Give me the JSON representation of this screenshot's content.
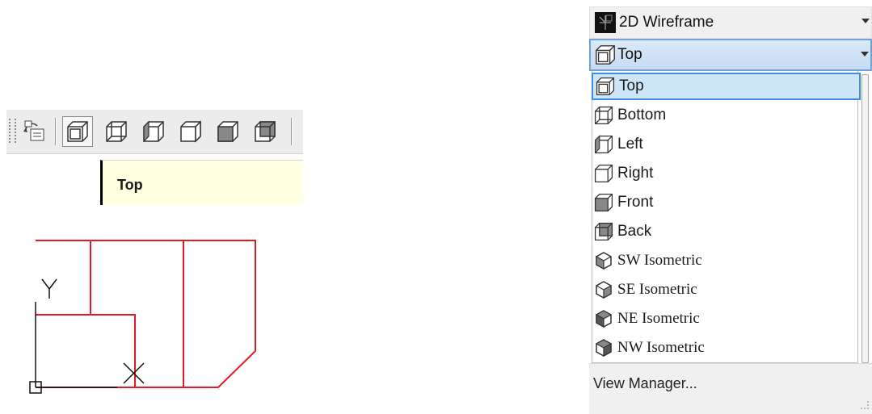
{
  "toolbar": {
    "buttons": [
      {
        "name": "named-views",
        "icon": "named-views-icon"
      },
      {
        "name": "top",
        "icon": "view-top-icon"
      },
      {
        "name": "bottom",
        "icon": "view-bottom-icon"
      },
      {
        "name": "left",
        "icon": "view-left-icon"
      },
      {
        "name": "right",
        "icon": "view-right-icon"
      },
      {
        "name": "front",
        "icon": "view-front-icon"
      },
      {
        "name": "back",
        "icon": "view-back-icon"
      }
    ],
    "tooltip": "Top"
  },
  "drawing": {
    "line_color": "#e01b24",
    "ucs_color": "#000000",
    "y_label": "Y",
    "x_label": "X"
  },
  "dropdown": {
    "visual_style": "2D Wireframe",
    "current_view": "Top",
    "items": [
      {
        "label": "Top",
        "icon": "view-top-icon",
        "selected": true
      },
      {
        "label": "Bottom",
        "icon": "view-bottom-icon",
        "selected": false
      },
      {
        "label": "Left",
        "icon": "view-left-icon",
        "selected": false
      },
      {
        "label": "Right",
        "icon": "view-right-icon",
        "selected": false
      },
      {
        "label": "Front",
        "icon": "view-front-icon",
        "selected": false
      },
      {
        "label": "Back",
        "icon": "view-back-icon",
        "selected": false
      },
      {
        "label": "SW Isometric",
        "icon": "sw-isometric-icon",
        "selected": false
      },
      {
        "label": "SE Isometric",
        "icon": "se-isometric-icon",
        "selected": false
      },
      {
        "label": "NE Isometric",
        "icon": "ne-isometric-icon",
        "selected": false
      },
      {
        "label": "NW Isometric",
        "icon": "nw-isometric-icon",
        "selected": false
      }
    ],
    "footer": "View Manager...",
    "selected_bg": "#cde6f7",
    "selected_border": "#3d8ee0"
  }
}
